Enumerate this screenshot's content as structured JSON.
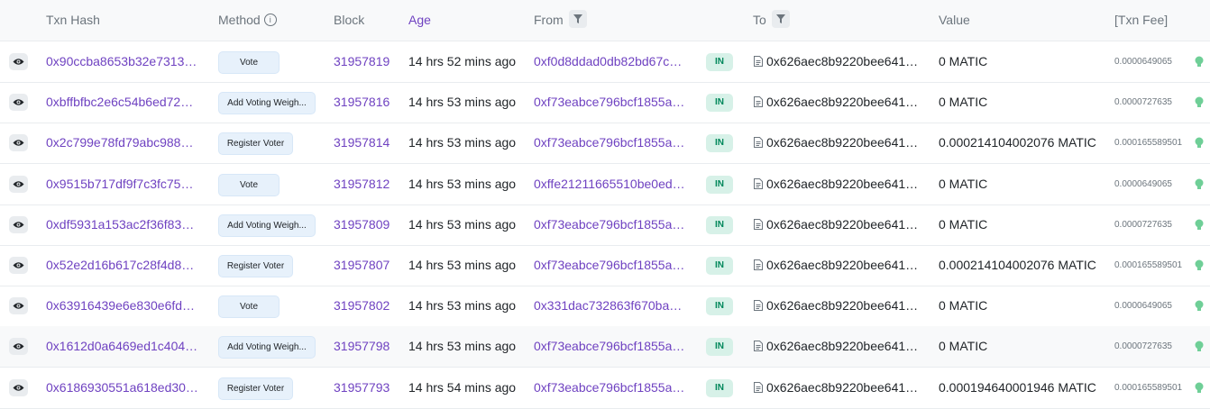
{
  "headers": {
    "txn_hash": "Txn Hash",
    "method": "Method",
    "block": "Block",
    "age": "Age",
    "from": "From",
    "to": "To",
    "value": "Value",
    "fee": "[Txn Fee]"
  },
  "icons": {
    "view": "eye-icon",
    "method_info": "info-icon",
    "filter": "filter-icon",
    "contract": "document-icon",
    "gas": "light-bulb-icon"
  },
  "colors": {
    "link": "#6f42c1",
    "in_badge": "#00875a",
    "gas_icon": "#6fcf97"
  },
  "rows": [
    {
      "hash": "0x90ccba8653b32e7313…",
      "method": "Vote",
      "block": "31957819",
      "age": "14 hrs 52 mins ago",
      "from": "0xf0d8ddad0db82bd67c…",
      "dir": "IN",
      "to": "0x626aec8b9220bee641…",
      "value": "0 MATIC",
      "fee": "0.0000649065"
    },
    {
      "hash": "0xbffbfbc2e6c54b6ed72…",
      "method": "Add Voting Weigh...",
      "block": "31957816",
      "age": "14 hrs 53 mins ago",
      "from": "0xf73eabce796bcf1855a…",
      "dir": "IN",
      "to": "0x626aec8b9220bee641…",
      "value": "0 MATIC",
      "fee": "0.0000727635"
    },
    {
      "hash": "0x2c799e78fd79abc988…",
      "method": "Register Voter",
      "block": "31957814",
      "age": "14 hrs 53 mins ago",
      "from": "0xf73eabce796bcf1855a…",
      "dir": "IN",
      "to": "0x626aec8b9220bee641…",
      "value": "0.000214104002076 MATIC",
      "fee": "0.000165589501"
    },
    {
      "hash": "0x9515b717df9f7c3fc75…",
      "method": "Vote",
      "block": "31957812",
      "age": "14 hrs 53 mins ago",
      "from": "0xffe21211665510be0ed…",
      "dir": "IN",
      "to": "0x626aec8b9220bee641…",
      "value": "0 MATIC",
      "fee": "0.0000649065"
    },
    {
      "hash": "0xdf5931a153ac2f36f83…",
      "method": "Add Voting Weigh...",
      "block": "31957809",
      "age": "14 hrs 53 mins ago",
      "from": "0xf73eabce796bcf1855a…",
      "dir": "IN",
      "to": "0x626aec8b9220bee641…",
      "value": "0 MATIC",
      "fee": "0.0000727635"
    },
    {
      "hash": "0x52e2d16b617c28f4d8…",
      "method": "Register Voter",
      "block": "31957807",
      "age": "14 hrs 53 mins ago",
      "from": "0xf73eabce796bcf1855a…",
      "dir": "IN",
      "to": "0x626aec8b9220bee641…",
      "value": "0.000214104002076 MATIC",
      "fee": "0.000165589501"
    },
    {
      "hash": "0x63916439e6e830e6fd…",
      "method": "Vote",
      "block": "31957802",
      "age": "14 hrs 53 mins ago",
      "from": "0x331dac732863f670ba…",
      "dir": "IN",
      "to": "0x626aec8b9220bee641…",
      "value": "0 MATIC",
      "fee": "0.0000649065"
    },
    {
      "hash": "0x1612d0a6469ed1c404…",
      "method": "Add Voting Weigh...",
      "block": "31957798",
      "age": "14 hrs 53 mins ago",
      "from": "0xf73eabce796bcf1855a…",
      "dir": "IN",
      "to": "0x626aec8b9220bee641…",
      "value": "0 MATIC",
      "fee": "0.0000727635"
    },
    {
      "hash": "0x6186930551a618ed30…",
      "method": "Register Voter",
      "block": "31957793",
      "age": "14 hrs 54 mins ago",
      "from": "0xf73eabce796bcf1855a…",
      "dir": "IN",
      "to": "0x626aec8b9220bee641…",
      "value": "0.000194640001946 MATIC",
      "fee": "0.000165589501"
    }
  ]
}
